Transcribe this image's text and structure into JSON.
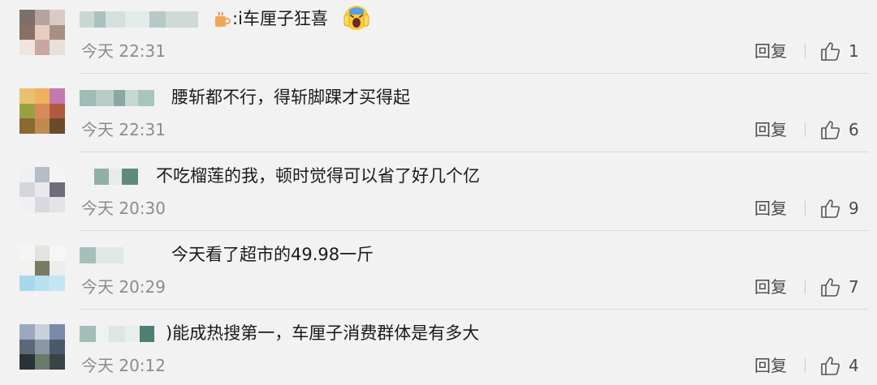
{
  "comments": [
    {
      "text": ":i车厘子狂喜",
      "time": "今天 22:31",
      "reply_label": "回复",
      "likes": "1",
      "badge_icon": "coffee-cup-icon",
      "trailing_emoji": "screaming-face-icon"
    },
    {
      "text": "腰斩都不行，得斩脚踝才买得起",
      "time": "今天 22:31",
      "reply_label": "回复",
      "likes": "6"
    },
    {
      "text": "不吃榴莲的我，顿时觉得可以省了好几个亿",
      "time": "今天 20:30",
      "reply_label": "回复",
      "likes": "9"
    },
    {
      "text": "今天看了超市的49.98一斤",
      "time": "今天 20:29",
      "reply_label": "回复",
      "likes": "7"
    },
    {
      "text": ")能成热搜第一，车厘子消费群体是有多大",
      "time": "今天 20:12",
      "reply_label": "回复",
      "likes": "4"
    }
  ]
}
